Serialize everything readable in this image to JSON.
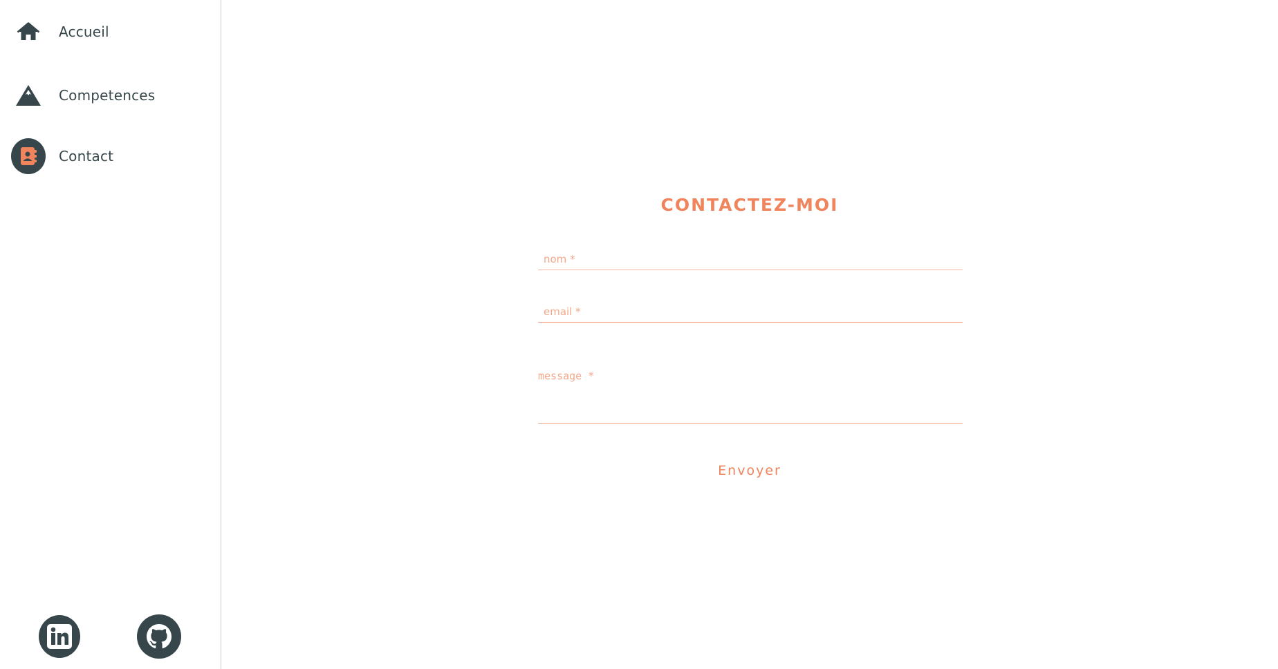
{
  "sidebar": {
    "items": [
      {
        "label": "Accueil",
        "icon": "home-icon"
      },
      {
        "label": "Competences",
        "icon": "mountain-icon"
      },
      {
        "label": "Contact",
        "icon": "address-book-icon",
        "active": true
      }
    ],
    "social": [
      {
        "icon": "linkedin-icon"
      },
      {
        "icon": "github-icon"
      }
    ]
  },
  "contact_form": {
    "title": "CONTACTEZ-MOI",
    "name_placeholder": "nom *",
    "email_placeholder": "email *",
    "message_placeholder": "message *",
    "submit_label": "Envoyer"
  },
  "colors": {
    "accent": "#f0845c",
    "dark": "#36464a",
    "border": "#c9c9c9"
  }
}
